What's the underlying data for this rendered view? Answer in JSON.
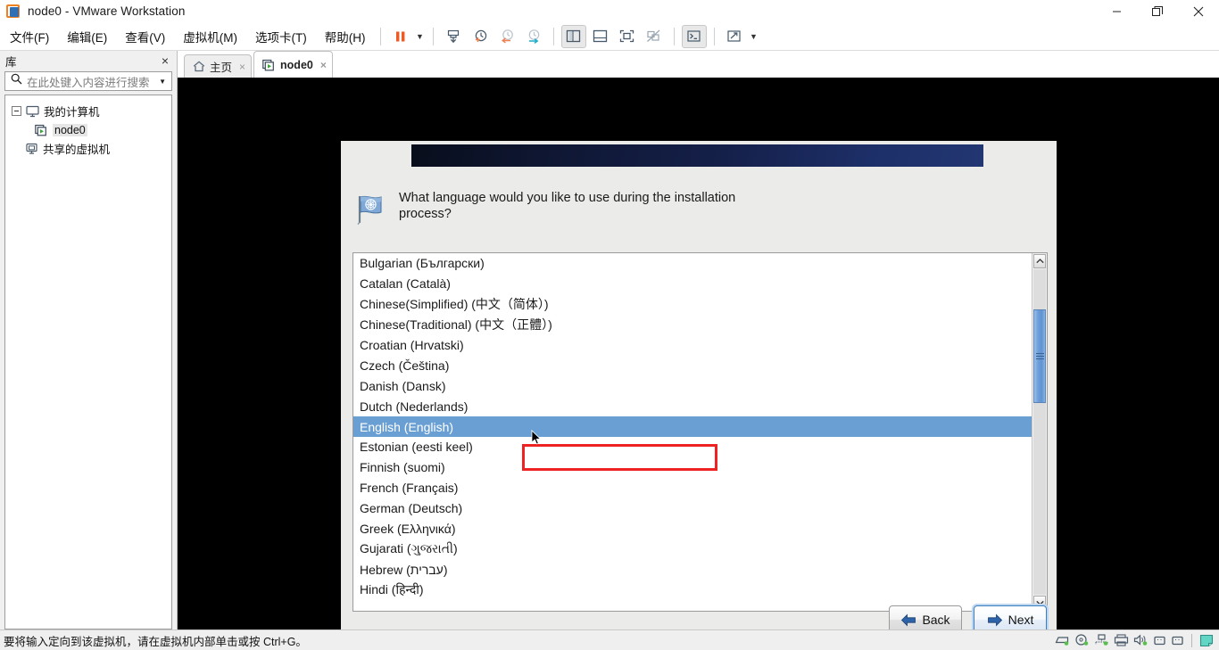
{
  "window": {
    "title": "node0 - VMware Workstation",
    "app_icon": "vmware-logo-icon",
    "minimize_label": "Minimize",
    "restore_label": "Restore",
    "close_label": "Close"
  },
  "menubar": {
    "items": [
      {
        "label": "文件(F)",
        "name": "menu-file"
      },
      {
        "label": "编辑(E)",
        "name": "menu-edit"
      },
      {
        "label": "查看(V)",
        "name": "menu-view"
      },
      {
        "label": "虚拟机(M)",
        "name": "menu-vm"
      },
      {
        "label": "选项卡(T)",
        "name": "menu-tabs"
      },
      {
        "label": "帮助(H)",
        "name": "menu-help"
      }
    ],
    "toolbar": [
      {
        "name": "suspend-button",
        "icon": "pause-icon"
      },
      {
        "name": "power-dropdown",
        "icon": "chevron-down-icon"
      },
      {
        "name": "snapshot-take-button",
        "icon": "snapshot-icon"
      },
      {
        "name": "snapshot-manage-button",
        "icon": "clock-plus-icon"
      },
      {
        "name": "revert-snapshot-button",
        "icon": "clock-back-icon"
      },
      {
        "name": "snapshot-manager-button",
        "icon": "clock-wrench-icon"
      },
      {
        "name": "show-library-button",
        "icon": "panel-left-icon"
      },
      {
        "name": "show-thumbnails-button",
        "icon": "panel-bottom-icon"
      },
      {
        "name": "fullscreen-button",
        "icon": "fullscreen-icon"
      },
      {
        "name": "unity-button",
        "icon": "unity-off-icon"
      },
      {
        "name": "console-button",
        "icon": "terminal-icon"
      },
      {
        "name": "stretch-button",
        "icon": "expand-arrows-icon"
      },
      {
        "name": "stretch-dropdown",
        "icon": "chevron-down-icon"
      }
    ]
  },
  "sidebar": {
    "title": "库",
    "close_label": "×",
    "search": {
      "placeholder": "在此处键入内容进行搜索",
      "icon": "search-icon",
      "dropdown_icon": "chevron-down-icon"
    },
    "tree": [
      {
        "label": "我的计算机",
        "icon": "computer-icon",
        "level": 1,
        "expanded": true,
        "selected": false
      },
      {
        "label": "node0",
        "icon": "vm-running-icon",
        "level": 2,
        "expanded": false,
        "selected": true
      },
      {
        "label": "共享的虚拟机",
        "icon": "shared-vm-icon",
        "level": 1,
        "expanded": false,
        "selected": false
      }
    ]
  },
  "tabs": [
    {
      "label": "主页",
      "icon": "home-icon",
      "active": false,
      "close_label": "×"
    },
    {
      "label": "node0",
      "icon": "vm-running-icon",
      "active": true,
      "close_label": "×"
    }
  ],
  "installer": {
    "banner_title": "",
    "flag_icon": "un-flag-icon",
    "prompt": "What language would you like to use during the installation process?",
    "languages": [
      {
        "label": "Bulgarian (Български)",
        "selected": false
      },
      {
        "label": "Catalan (Català)",
        "selected": false
      },
      {
        "label": "Chinese(Simplified) (中文（简体）)",
        "selected": false
      },
      {
        "label": "Chinese(Traditional) (中文（正體）)",
        "selected": false
      },
      {
        "label": "Croatian (Hrvatski)",
        "selected": false
      },
      {
        "label": "Czech (Čeština)",
        "selected": false
      },
      {
        "label": "Danish (Dansk)",
        "selected": false
      },
      {
        "label": "Dutch (Nederlands)",
        "selected": false
      },
      {
        "label": "English (English)",
        "selected": true
      },
      {
        "label": "Estonian (eesti keel)",
        "selected": false
      },
      {
        "label": "Finnish (suomi)",
        "selected": false
      },
      {
        "label": "French (Français)",
        "selected": false
      },
      {
        "label": "German (Deutsch)",
        "selected": false
      },
      {
        "label": "Greek (Ελληνικά)",
        "selected": false
      },
      {
        "label": "Gujarati (ગુજરાતી)",
        "selected": false
      },
      {
        "label": "Hebrew (עברית)",
        "selected": false
      },
      {
        "label": "Hindi (हिन्दी)",
        "selected": false
      }
    ],
    "scrollbar": {
      "up_icon": "chevron-up-icon",
      "down_icon": "chevron-down-icon",
      "grip_icon": "grip-icon"
    },
    "buttons": {
      "back": {
        "label": "Back",
        "icon": "arrow-left-icon",
        "focused": false
      },
      "next": {
        "label": "Next",
        "icon": "arrow-right-icon",
        "focused": true
      }
    },
    "annotation_color": "#ee2222",
    "selection_color": "#6a9fd4"
  },
  "statusbar": {
    "message": "要将输入定向到该虚拟机，请在虚拟机内部单击或按 Ctrl+G。",
    "devices": [
      {
        "name": "hard-disk-icon"
      },
      {
        "name": "cd-dvd-icon"
      },
      {
        "name": "network-adapter-icon"
      },
      {
        "name": "printer-icon"
      },
      {
        "name": "sound-card-icon"
      },
      {
        "name": "usb-device-1-icon"
      },
      {
        "name": "usb-device-2-icon"
      },
      {
        "name": "input-capture-icon"
      }
    ]
  }
}
